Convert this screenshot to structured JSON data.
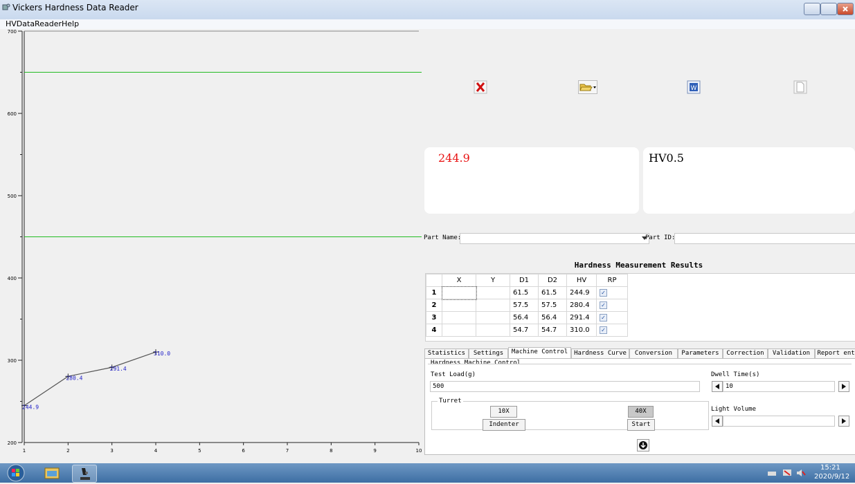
{
  "window": {
    "title": "Vickers Hardness Data Reader"
  },
  "menu": {
    "items": [
      "HVDataReader",
      "Help"
    ]
  },
  "chart_data": {
    "type": "line",
    "x": [
      1,
      2,
      3,
      4
    ],
    "values": [
      244.9,
      280.4,
      291.4,
      310.0
    ],
    "point_labels": [
      "244.9",
      "280.4",
      "291.4",
      "310.0"
    ],
    "xlim": [
      1,
      10
    ],
    "ylim": [
      200,
      700
    ],
    "x_ticks": [
      "1",
      "2",
      "3",
      "4",
      "5",
      "6",
      "7",
      "8",
      "9",
      "10"
    ],
    "y_ticks": [
      "200",
      "300",
      "400",
      "500",
      "600",
      "700"
    ],
    "limit_lines": [
      450,
      650
    ],
    "colors": {
      "series": "#555555",
      "labels": "#2020c8",
      "limits": "#22bb22"
    }
  },
  "toolbar": {
    "icons": [
      "delete-icon",
      "open-folder-icon",
      "word-export-icon",
      "blank-document-icon"
    ]
  },
  "values": {
    "hardness": "244.9",
    "scale": "HV0.5",
    "hardness_color": "#e81010"
  },
  "part": {
    "name_label": "Part Name:",
    "name_value": "",
    "id_label": "Part ID:",
    "id_value": ""
  },
  "results": {
    "title": "Hardness Measurement Results",
    "columns": [
      "X",
      "Y",
      "D1",
      "D2",
      "HV",
      "RP"
    ],
    "rows": [
      {
        "n": "1",
        "x": "",
        "y": "",
        "d1": "61.5",
        "d2": "61.5",
        "hv": "244.9",
        "rp": true
      },
      {
        "n": "2",
        "x": "",
        "y": "",
        "d1": "57.5",
        "d2": "57.5",
        "hv": "280.4",
        "rp": true
      },
      {
        "n": "3",
        "x": "",
        "y": "",
        "d1": "56.4",
        "d2": "56.4",
        "hv": "291.4",
        "rp": true
      },
      {
        "n": "4",
        "x": "",
        "y": "",
        "d1": "54.7",
        "d2": "54.7",
        "hv": "310.0",
        "rp": true
      }
    ]
  },
  "tabs": [
    "Statistics",
    "Settings",
    "Machine Control",
    "Hardness Curve",
    "Conversion",
    "Parameters",
    "Correction",
    "Validation",
    "Report entry"
  ],
  "machine": {
    "group_title": "Hardness Machine Control",
    "test_load_label": "Test Load(g)",
    "test_load_value": "500",
    "dwell_label": "Dwell Time(s)",
    "dwell_value": "10",
    "turret_label": "Turret",
    "btn_10x": "10X",
    "btn_40x": "40X",
    "btn_indenter": "Indenter",
    "btn_start": "Start",
    "light_label": "Light Volume"
  },
  "taskbar": {
    "time": "15:21",
    "date": "2020/9/12"
  }
}
